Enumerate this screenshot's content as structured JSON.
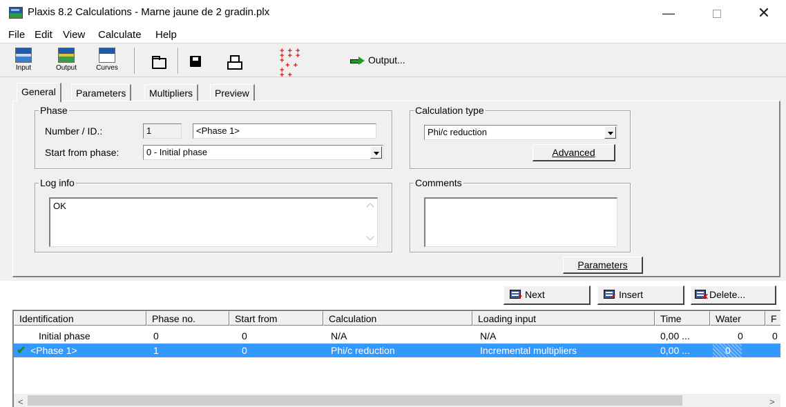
{
  "window": {
    "title": "Plaxis 8.2 Calculations - Marne jaune de 2 gradin.plx",
    "min": "—",
    "close": "✕"
  },
  "menu": [
    "File",
    "Edit",
    "View",
    "Calculate",
    "Help"
  ],
  "toolbar": {
    "input_label": "Input",
    "output_label": "Output",
    "curves_label": "Curves",
    "output_button": "Output...",
    "icons": [
      "folder-open-icon",
      "save-icon",
      "print-icon",
      "mesh-points-icon",
      "green-arrow-icon"
    ]
  },
  "tabs": [
    "General",
    "Parameters",
    "Multipliers",
    "Preview"
  ],
  "phase": {
    "group_title": "Phase",
    "number_label": "Number / ID.:",
    "number_value": "1",
    "id_value": "<Phase 1>",
    "start_label": "Start from phase:",
    "start_value": "0 - Initial phase"
  },
  "calc_type": {
    "group_title": "Calculation type",
    "value": "Phi/c reduction",
    "advanced_button": "Advanced"
  },
  "log": {
    "group_title": "Log info",
    "text": "OK"
  },
  "comments": {
    "group_title": "Comments",
    "text": ""
  },
  "parameters_button": "Parameters",
  "actions": {
    "next": "Next",
    "insert": "Insert",
    "delete": "Delete..."
  },
  "table": {
    "columns": [
      "Identification",
      "Phase no.",
      "Start from",
      "Calculation",
      "Loading input",
      "Time",
      "Water",
      "F"
    ],
    "rows": [
      {
        "id": "Initial phase",
        "phase_no": "0",
        "start_from": "0",
        "calculation": "N/A",
        "loading": "N/A",
        "time": "0,00 ...",
        "water": "0",
        "extra": "0",
        "selected": false
      },
      {
        "id": "<Phase 1>",
        "phase_no": "1",
        "start_from": "0",
        "calculation": "Phi/c reduction",
        "loading": "Incremental multipliers",
        "time": "0,00 ...",
        "water": "0",
        "extra": "",
        "selected": true
      }
    ]
  },
  "colors": {
    "selection": "#3399ff",
    "window_bg": "#f0f0f0",
    "check": "#1a8a1a"
  }
}
